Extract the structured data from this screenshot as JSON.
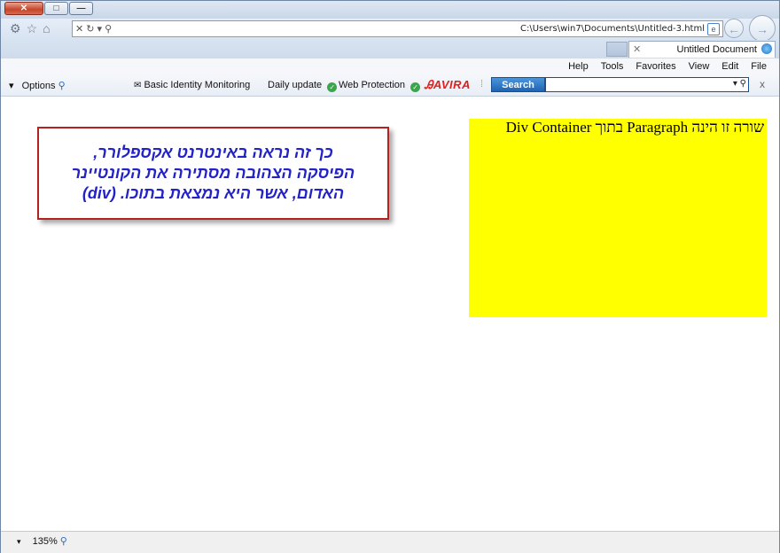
{
  "window": {
    "close_label": "✕",
    "restore_label": "□",
    "minimize_label": "—"
  },
  "address_bar": {
    "url": "C:\\Users\\win7\\Documents\\Untitled-3.html",
    "controls": "✕ ↻ ▾ ⚲"
  },
  "tab": {
    "close_label": "✕",
    "title": "Untitled Document"
  },
  "menu": {
    "items": [
      "Help",
      "Tools",
      "Favorites",
      "View",
      "Edit",
      "File"
    ]
  },
  "toolbar": {
    "options_label": "Options",
    "identity_label": "Basic Identity Monitoring",
    "daily_update_label": "Daily update",
    "web_protection_label": "Web Protection",
    "brand": "AVIRA",
    "search_button": "Search",
    "close_label": "x"
  },
  "page": {
    "paragraph_text": "שורה זו הינה Paragraph בתוך Div Container",
    "callout_text": "כך זה נראה באינטרנט אקספלורר,\nהפיסקה הצהובה מסתירה את הקונטיינר\nהאדום, אשר היא נמצאת בתוכו. (div)"
  },
  "status": {
    "zoom": "135%"
  },
  "colors": {
    "paragraph_bg": "#ffff00",
    "callout_border": "#b52020",
    "callout_text": "#2222c8",
    "brand_red": "#e0201c"
  }
}
